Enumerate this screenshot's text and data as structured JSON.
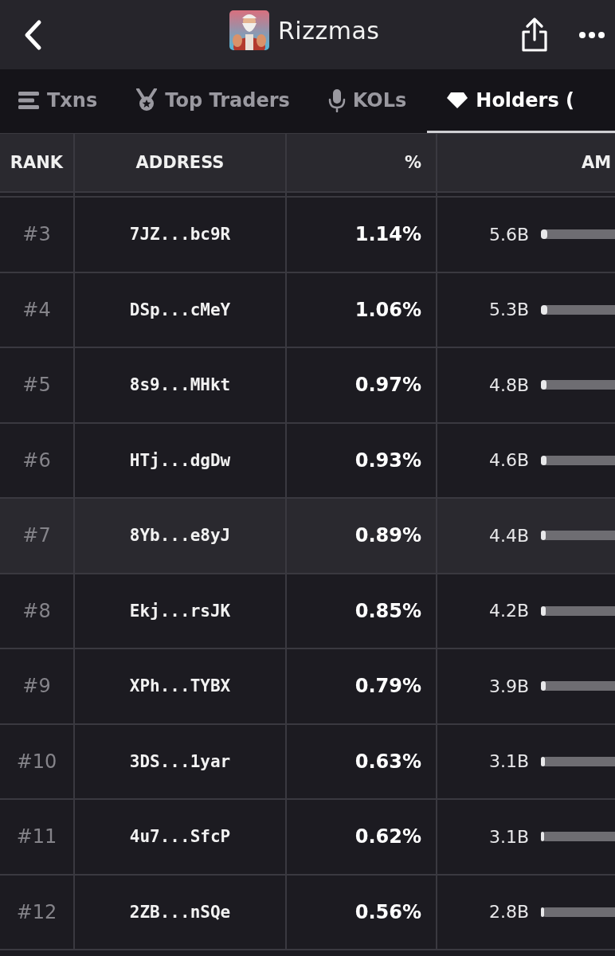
{
  "header": {
    "title": "Rizzmas"
  },
  "tabs": [
    {
      "label": "Txns",
      "selected": false
    },
    {
      "label": "Top Traders",
      "selected": false
    },
    {
      "label": "KOLs",
      "selected": false
    },
    {
      "label": "Holders (",
      "selected": true
    }
  ],
  "table": {
    "columns": [
      "RANK",
      "ADDRESS",
      "%",
      "AM"
    ],
    "rows": [
      {
        "rank": "#3",
        "address": "7JZ...bc9R",
        "percent": "1.14%",
        "amount": "5.6B",
        "level": 0.0114,
        "selected": false
      },
      {
        "rank": "#4",
        "address": "DSp...cMeY",
        "percent": "1.06%",
        "amount": "5.3B",
        "level": 0.0106,
        "selected": false
      },
      {
        "rank": "#5",
        "address": "8s9...MHkt",
        "percent": "0.97%",
        "amount": "4.8B",
        "level": 0.0097,
        "selected": false
      },
      {
        "rank": "#6",
        "address": "HTj...dgDw",
        "percent": "0.93%",
        "amount": "4.6B",
        "level": 0.0093,
        "selected": false
      },
      {
        "rank": "#7",
        "address": "8Yb...e8yJ",
        "percent": "0.89%",
        "amount": "4.4B",
        "level": 0.0089,
        "selected": true
      },
      {
        "rank": "#8",
        "address": "Ekj...rsJK",
        "percent": "0.85%",
        "amount": "4.2B",
        "level": 0.0085,
        "selected": false
      },
      {
        "rank": "#9",
        "address": "XPh...TYBX",
        "percent": "0.79%",
        "amount": "3.9B",
        "level": 0.0079,
        "selected": false
      },
      {
        "rank": "#10",
        "address": "3DS...1yar",
        "percent": "0.63%",
        "amount": "3.1B",
        "level": 0.0063,
        "selected": false
      },
      {
        "rank": "#11",
        "address": "4u7...SfcP",
        "percent": "0.62%",
        "amount": "3.1B",
        "level": 0.0062,
        "selected": false
      },
      {
        "rank": "#12",
        "address": "2ZB...nSQe",
        "percent": "0.56%",
        "amount": "2.8B",
        "level": 0.0056,
        "selected": false
      }
    ]
  }
}
